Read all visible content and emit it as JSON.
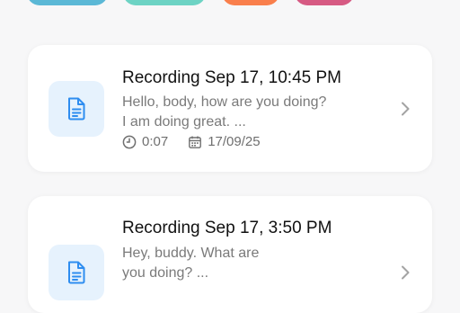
{
  "colors": {
    "pill_teal_blue": "#5bb8d6",
    "pill_mint": "#6dd3c4",
    "pill_orange": "#f97f4c",
    "pill_pink": "#d65a83",
    "doc_tile_bg": "#e6f2fd",
    "doc_icon": "#2e8df0"
  },
  "recordings": [
    {
      "title": "Recording Sep 17, 10:45 PM",
      "preview_line1": "Hello, body, how are you doing?",
      "preview_line2": "I am doing great. ...",
      "duration": "0:07",
      "date": "17/09/25"
    },
    {
      "title": "Recording Sep 17, 3:50 PM",
      "preview_line1": "Hey, buddy. What are",
      "preview_line2": "you doing? ..."
    }
  ],
  "icons": {
    "doc": "document-icon",
    "clock": "clock-icon",
    "calendar": "calendar-icon",
    "chevron": "chevron-right-icon"
  }
}
